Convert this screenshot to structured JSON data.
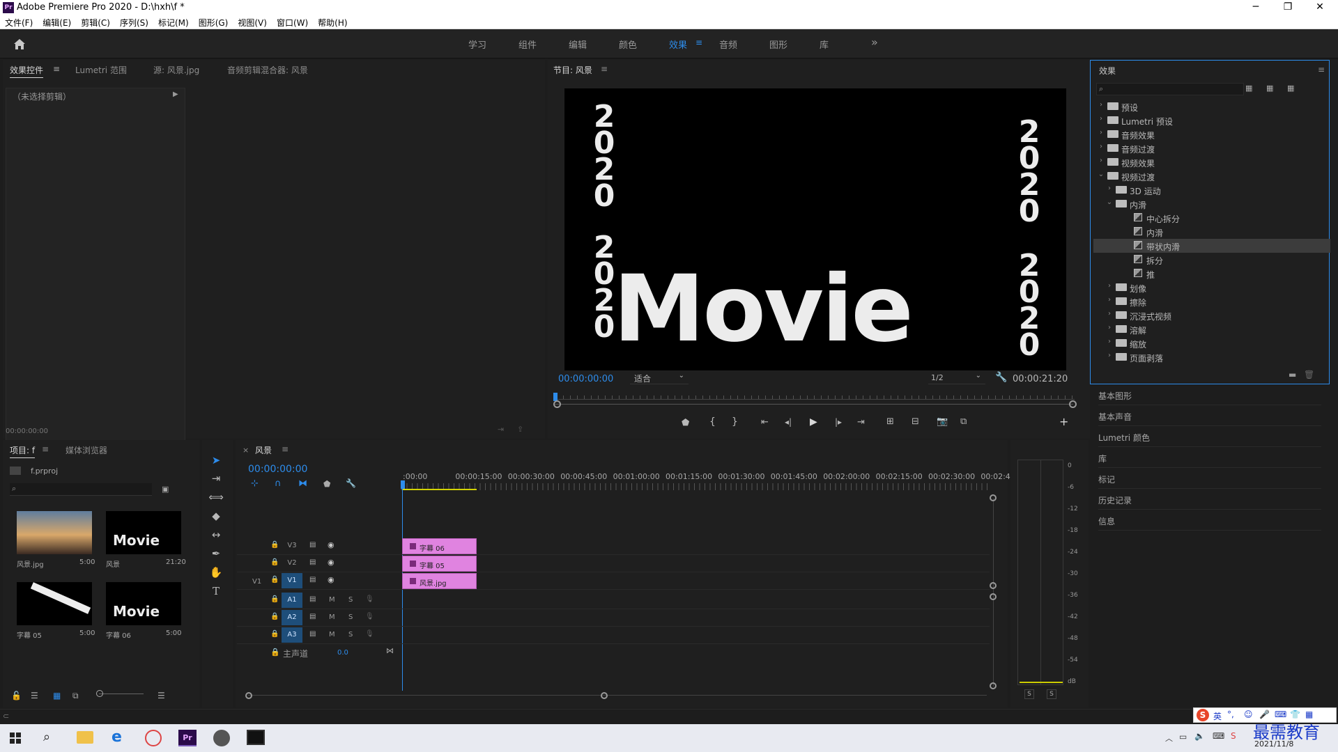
{
  "window": {
    "logo": "Pr",
    "title": "Adobe Premiere Pro 2020 - D:\\hxh\\f *",
    "minimize": "─",
    "maximize": "❐",
    "close": "✕"
  },
  "menu": [
    "文件(F)",
    "编辑(E)",
    "剪辑(C)",
    "序列(S)",
    "标记(M)",
    "图形(G)",
    "视图(V)",
    "窗口(W)",
    "帮助(H)"
  ],
  "workspaces": {
    "items": [
      "学习",
      "组件",
      "编辑",
      "颜色",
      "效果",
      "音频",
      "图形",
      "库"
    ],
    "active": "效果",
    "more": "»"
  },
  "source_panel": {
    "tabs": [
      "效果控件",
      "Lumetri 范围",
      "源: 风景.jpg",
      "音频剪辑混合器: 风景"
    ],
    "no_clip": "（未选择剪辑）",
    "timecode": "00:00:00:00"
  },
  "program": {
    "title": "节目: 风景",
    "timecode": "00:00:00:00",
    "fit": "适合",
    "resolution": "1/2",
    "duration": "00:00:21:20",
    "video": {
      "left_top": [
        "2",
        "0",
        "2",
        "0"
      ],
      "left_bottom": [
        "2",
        "0",
        "2",
        "0"
      ],
      "right_top": [
        "2",
        "0",
        "2",
        "0"
      ],
      "right_bottom": [
        "2",
        "0",
        "2",
        "0"
      ],
      "movie": "Movie"
    }
  },
  "effects": {
    "title": "效果",
    "tree": [
      {
        "label": "预设",
        "level": 0,
        "kind": "folder",
        "chev": "›"
      },
      {
        "label": "Lumetri 预设",
        "level": 0,
        "kind": "folder",
        "chev": "›"
      },
      {
        "label": "音频效果",
        "level": 0,
        "kind": "folder",
        "chev": "›"
      },
      {
        "label": "音频过渡",
        "level": 0,
        "kind": "folder",
        "chev": "›"
      },
      {
        "label": "视频效果",
        "level": 0,
        "kind": "folder",
        "chev": "›"
      },
      {
        "label": "视频过渡",
        "level": 0,
        "kind": "folder",
        "chev": "⌄"
      },
      {
        "label": "3D 运动",
        "level": 1,
        "kind": "folder",
        "chev": "›"
      },
      {
        "label": "内滑",
        "level": 1,
        "kind": "folder",
        "chev": "⌄"
      },
      {
        "label": "中心拆分",
        "level": 2,
        "kind": "fx"
      },
      {
        "label": "内滑",
        "level": 2,
        "kind": "fx"
      },
      {
        "label": "带状内滑",
        "level": 2,
        "kind": "fx",
        "selected": true
      },
      {
        "label": "拆分",
        "level": 2,
        "kind": "fx"
      },
      {
        "label": "推",
        "level": 2,
        "kind": "fx"
      },
      {
        "label": "划像",
        "level": 1,
        "kind": "folder",
        "chev": "›"
      },
      {
        "label": "擦除",
        "level": 1,
        "kind": "folder",
        "chev": "›"
      },
      {
        "label": "沉浸式视频",
        "level": 1,
        "kind": "folder",
        "chev": "›"
      },
      {
        "label": "溶解",
        "level": 1,
        "kind": "folder",
        "chev": "›"
      },
      {
        "label": "缩放",
        "level": 1,
        "kind": "folder",
        "chev": "›"
      },
      {
        "label": "页面剥落",
        "level": 1,
        "kind": "folder",
        "chev": "›"
      }
    ]
  },
  "side_panels": [
    "基本图形",
    "基本声音",
    "Lumetri 颜色",
    "库",
    "标记",
    "历史记录",
    "信息"
  ],
  "project": {
    "tabs": [
      "项目: f",
      "媒体浏览器"
    ],
    "file": "f.prproj",
    "items": [
      {
        "name": "风景.jpg",
        "dur": "5:00"
      },
      {
        "name": "风景",
        "dur": "21:20"
      },
      {
        "name": "字幕 05",
        "dur": "5:00"
      },
      {
        "name": "字幕 06",
        "dur": "5:00"
      }
    ],
    "thumb_movie": "Movie"
  },
  "timeline": {
    "title": "风景",
    "timecode": "00:00:00:00",
    "ruler": [
      ":00:00",
      "00:00:15:00",
      "00:00:30:00",
      "00:00:45:00",
      "00:01:00:00",
      "00:01:15:00",
      "00:01:30:00",
      "00:01:45:00",
      "00:02:00:00",
      "00:02:15:00",
      "00:02:30:00",
      "00:02:45:"
    ],
    "video_tracks": [
      "V3",
      "V2",
      "V1"
    ],
    "source_patch": "V1",
    "audio_tracks": [
      "A1",
      "A2",
      "A3"
    ],
    "mute": "M",
    "solo": "S",
    "master": "主声道",
    "master_value": "0.0",
    "clips": [
      "字幕 06",
      "字幕 05",
      "风景.jpg"
    ]
  },
  "meter": {
    "scale": [
      "0",
      "-6",
      "-12",
      "-18",
      "-24",
      "-30",
      "-36",
      "-42",
      "-48",
      "-54",
      "dB"
    ],
    "solo": [
      "S",
      "S"
    ]
  },
  "taskbar": {
    "ime": "英",
    "brand": "最需教育",
    "date": "2021/11/8"
  }
}
